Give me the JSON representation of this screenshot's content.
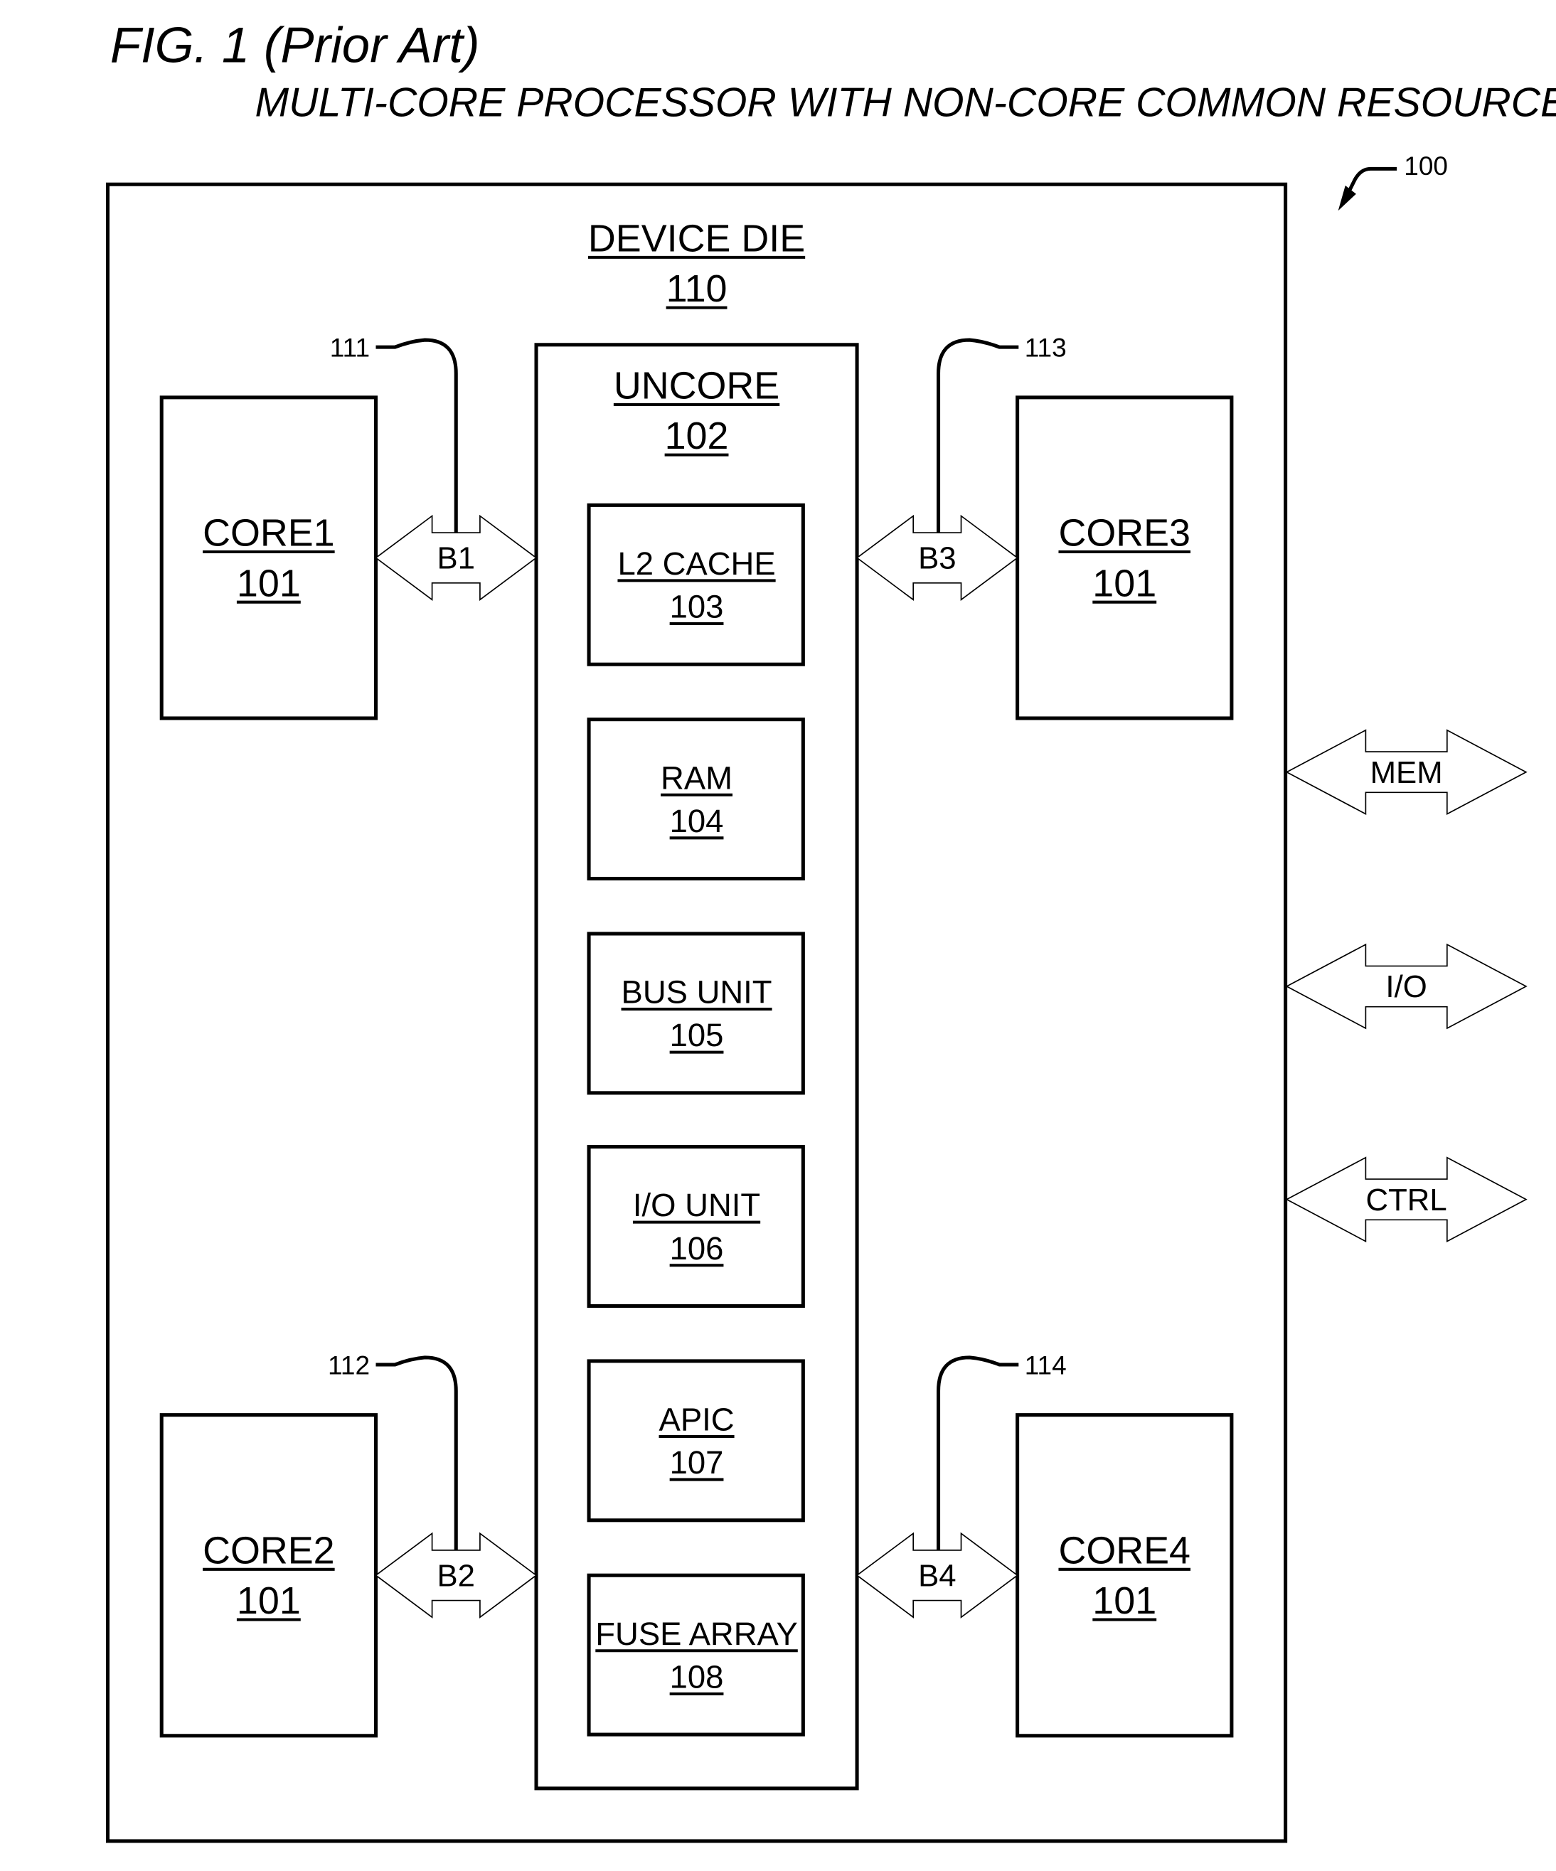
{
  "figure": {
    "title": "FIG. 1 (Prior Art)",
    "subtitle": "MULTI-CORE PROCESSOR WITH NON-CORE COMMON RESOURCES",
    "reference": "100"
  },
  "die": {
    "label": "DEVICE DIE",
    "number": "110"
  },
  "uncore": {
    "label": "UNCORE",
    "number": "102",
    "units": [
      {
        "label": "L2 CACHE",
        "number": "103"
      },
      {
        "label": "RAM",
        "number": "104"
      },
      {
        "label": "BUS UNIT",
        "number": "105"
      },
      {
        "label": "I/O UNIT",
        "number": "106"
      },
      {
        "label": "APIC",
        "number": "107"
      },
      {
        "label": "FUSE ARRAY",
        "number": "108"
      }
    ]
  },
  "cores": [
    {
      "label": "CORE1",
      "number": "101"
    },
    {
      "label": "CORE2",
      "number": "101"
    },
    {
      "label": "CORE3",
      "number": "101"
    },
    {
      "label": "CORE4",
      "number": "101"
    }
  ],
  "buses": [
    {
      "label": "B1",
      "ref": "111"
    },
    {
      "label": "B2",
      "ref": "112"
    },
    {
      "label": "B3",
      "ref": "113"
    },
    {
      "label": "B4",
      "ref": "114"
    }
  ],
  "external_interfaces": [
    {
      "label": "MEM"
    },
    {
      "label": "I/O"
    },
    {
      "label": "CTRL"
    }
  ]
}
